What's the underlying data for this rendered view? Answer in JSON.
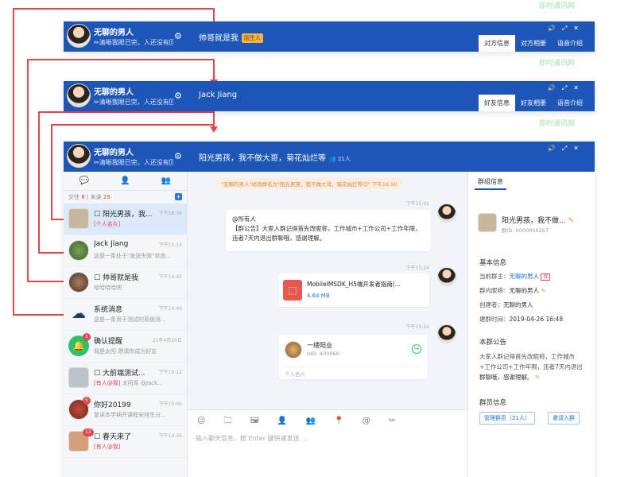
{
  "me": {
    "name": "无聊的男人",
    "signature": "✏清晰我眼已完，人还没有回"
  },
  "windows": [
    {
      "title": "帅哥就是我",
      "tag": "陌生人",
      "tabs": [
        "对方信息",
        "对方相册",
        "语音介绍"
      ]
    },
    {
      "title": "Jack Jiang",
      "tabs": [
        "好友信息",
        "好友相册",
        "语音介绍"
      ]
    },
    {
      "title": "阳光男孩，我不做大哥，菊花灿烂等",
      "member_count": "21人",
      "tabs": [
        "群组信息"
      ]
    }
  ],
  "left_tabs": [
    "💬",
    "👤",
    "👥"
  ],
  "counts": {
    "label1": "交往",
    "num1": "8",
    "label2": "未读",
    "num2": "29"
  },
  "conversations": [
    {
      "title": "阳光男孩，我...",
      "time": "下午16:34",
      "sub_tag": "[个人名片]",
      "sub": ""
    },
    {
      "title": "Jack Jiang",
      "time": "下午15:15",
      "sub_tag": "",
      "sub": "这是一条处于\"发送失败\"状态..."
    },
    {
      "title": "帅哥就是我",
      "time": "下午14:45",
      "sub_tag": "",
      "sub": "哈哈哈哈吧"
    },
    {
      "title": "系统消息",
      "time": "下午14:40",
      "sub_tag": "",
      "sub": "这是一条用于测试的系统消..."
    },
    {
      "title": "确认提醒",
      "time": "21年4月20日",
      "sub_tag": "",
      "sub": "我是太阳 邀请你成为好友"
    },
    {
      "title": "大前端测试...",
      "time": "下午16:12",
      "sub_tag": "[有人@我]",
      "sub": "太阳系 @Jack..."
    },
    {
      "title": "你好20199",
      "time": "下午15:00",
      "sub_tag": "",
      "sub": "复读本学期开课程安排生分..."
    },
    {
      "title": "春天来了",
      "time": "下午14:35",
      "sub_tag": "[有人@我]",
      "sub": ""
    }
  ],
  "badges": [
    "1",
    "5",
    "12"
  ],
  "chat": {
    "notice": "\"无聊的男人\"修改群名为\"阳光男孩，我不做大哥，菊花灿烂等😊\"  下午16:50",
    "msg1_time": "下午15:01",
    "msg1_at": "@所有人",
    "msg1_text": "【群公告】大家入群记得首先改昵称，工作城市+工作公司+工作年限，违者7天内退出群聊哦，感谢理解。",
    "msg2_time": "下午15:24",
    "file_name": "MobileIMSDK_H5端开发者指南(...",
    "file_size": "4.64 MB",
    "msg3_time": "下午15:24",
    "card_name": "一缕阳业",
    "card_uid": "UID: 400060",
    "card_type": "个人名片",
    "toolbar_icons": "☺ 🗀 🖼 👤 👥 📍 @ ✂",
    "input_placeholder": "输入聊天信息，按 Enter 键快速发送 ..."
  },
  "info": {
    "group_name": "阳光男孩，我不做...",
    "group_id": "群ID: 0000000267",
    "basic_title": "基本信息",
    "owner_label": "当前群主：",
    "owner_value": "无聊的男人",
    "owner_tag": "我",
    "nick_label": "群内昵称：",
    "nick_value": "无聊的男人",
    "creator_label": "创建者：",
    "creator_value": "无聊的男人",
    "created_label": "建群时间：",
    "created_value": "2019-04-26 16:48",
    "notice_title": "本群公告",
    "notice_text1": "大家入群记得首先改昵称，工作城市",
    "notice_text2": "+工作公司+工作年限，违者7天内退出",
    "notice_text3": "群聊哦，感谢理解。",
    "members_title": "群员信息",
    "manage_btn": "管理群员（21人）",
    "invite_btn": "邀请入群"
  },
  "watermark": "即时通讯网",
  "colors": {
    "accent": "#1e56b8",
    "annotation": "#e0474c"
  }
}
